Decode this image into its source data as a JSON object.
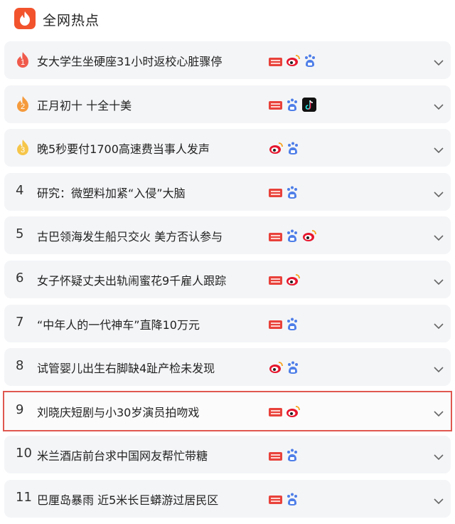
{
  "header": {
    "title": "全网热点",
    "logo_icon": "flame-logo-icon",
    "logo_color": "#f2532d"
  },
  "colors": {
    "rank1": "#f05a4b",
    "rank2": "#f59a3c",
    "rank3": "#f6c64a",
    "highlight_border": "#e0584f"
  },
  "items": [
    {
      "rank": "1",
      "title": "女大学生坐硬座31小时返校心脏骤停",
      "sources": [
        "toutiao",
        "weibo",
        "baidu"
      ]
    },
    {
      "rank": "2",
      "title": "正月初十 十全十美",
      "sources": [
        "toutiao",
        "baidu",
        "douyin"
      ]
    },
    {
      "rank": "3",
      "title": "晚5秒要付1700高速费当事人发声",
      "sources": [
        "weibo",
        "baidu"
      ]
    },
    {
      "rank": "4",
      "title": "研究：微塑料加紧“入侵”大脑",
      "sources": [
        "toutiao",
        "baidu"
      ]
    },
    {
      "rank": "5",
      "title": "古巴领海发生船只交火 美方否认参与",
      "sources": [
        "toutiao",
        "baidu",
        "weibo"
      ]
    },
    {
      "rank": "6",
      "title": "女子怀疑丈夫出轨闹蜜花9千雇人跟踪",
      "sources": [
        "toutiao",
        "weibo"
      ]
    },
    {
      "rank": "7",
      "title": "“中年人的一代神车”直降10万元",
      "sources": [
        "toutiao",
        "baidu"
      ]
    },
    {
      "rank": "8",
      "title": "试管婴儿出生右脚缺4趾产检未发现",
      "sources": [
        "weibo",
        "baidu"
      ]
    },
    {
      "rank": "9",
      "title": "刘晓庆短剧与小30岁演员拍吻戏",
      "sources": [
        "toutiao",
        "weibo"
      ],
      "highlighted": true
    },
    {
      "rank": "10",
      "title": "米兰酒店前台求中国网友帮忙带糖",
      "sources": [
        "toutiao",
        "baidu"
      ]
    },
    {
      "rank": "11",
      "title": "巴厘岛暴雨 近5米长巨蟒游过居民区",
      "sources": [
        "toutiao",
        "baidu"
      ]
    }
  ]
}
